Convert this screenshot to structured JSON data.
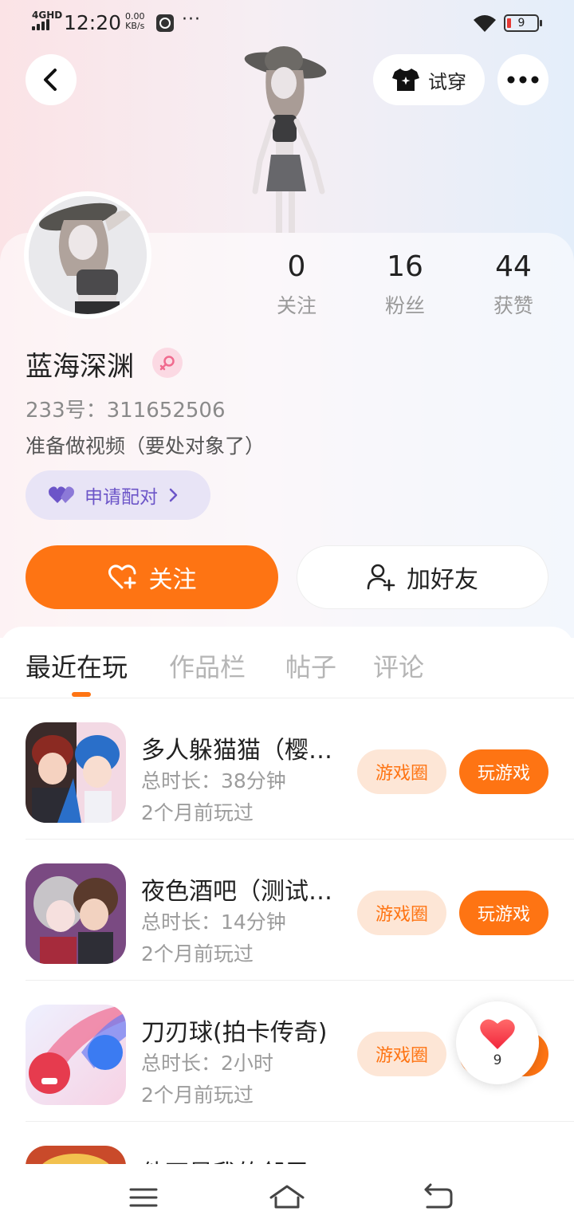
{
  "status_bar": {
    "network": "4GHD",
    "time": "12:20",
    "speed_value": "0.00",
    "speed_unit": "KB/s",
    "dots": "···",
    "battery": "9"
  },
  "top_nav": {
    "try_on_label": "试穿"
  },
  "profile": {
    "stats": [
      {
        "value": "0",
        "label": "关注"
      },
      {
        "value": "16",
        "label": "粉丝"
      },
      {
        "value": "44",
        "label": "获赞"
      }
    ],
    "username": "蓝海深渊",
    "uid": "233号：311652506",
    "bio": "准备做视频（要处对象了）",
    "pair_label": "申请配对",
    "follow_label": "关注",
    "add_friend_label": "加好友"
  },
  "tabs": [
    "最近在玩",
    "作品栏",
    "帖子",
    "评论"
  ],
  "games": [
    {
      "title": "多人躲猫猫（樱花校园）",
      "duration": "总时长：38分钟",
      "last_played": "2个月前玩过"
    },
    {
      "title": "夜色酒吧（测试服）",
      "duration": "总时长：14分钟",
      "last_played": "2个月前玩过"
    },
    {
      "title": "刀刃球(拍卡传奇)",
      "duration": "总时长：2小时",
      "last_played": "2个月前玩过"
    },
    {
      "title": "他不是我的邻居",
      "duration": "",
      "last_played": ""
    }
  ],
  "game_buttons": {
    "circle": "游戏圈",
    "play": "玩游戏"
  },
  "like_float": {
    "count": "9"
  },
  "colors": {
    "accent": "#fe7413",
    "accent_light": "#fde6d6",
    "pair_purple": "#6c55c8"
  }
}
